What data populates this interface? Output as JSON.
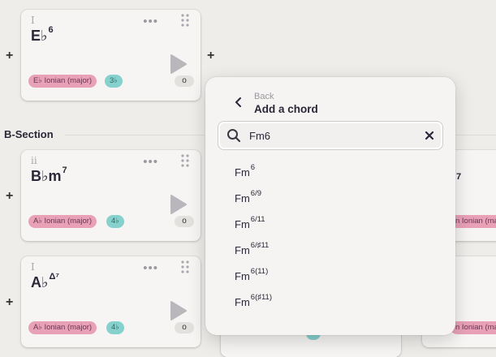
{
  "cards": [
    {
      "numeral": "I",
      "root": "E♭",
      "quality": "6",
      "scale_tag": "E♭ Ionian (major)",
      "acc_tag": "3♭",
      "circle": "o"
    },
    {
      "numeral": "ii",
      "root": "B♭m",
      "quality": "7",
      "scale_tag": "A♭ Ionian (major)",
      "acc_tag": "4♭",
      "circle": "o"
    },
    {
      "numeral": "I",
      "root": "A♭",
      "quality": "Δ⁷",
      "scale_tag": "A♭ Ionian (major)",
      "acc_tag": "4♭",
      "circle": "o"
    }
  ],
  "right_cards": [
    {
      "quality": "7",
      "scale_tag": "n Ionian (major)"
    },
    {
      "scale_tag": "n Ionian (major)"
    }
  ],
  "plus": "+",
  "section": {
    "title": "B-Section"
  },
  "popup": {
    "back_label": "Back",
    "title": "Add a chord",
    "search_value": "Fm6",
    "results": [
      {
        "base": "Fm",
        "ext": "6"
      },
      {
        "base": "Fm",
        "ext": "6/9"
      },
      {
        "base": "Fm",
        "ext": "6/11"
      },
      {
        "base": "Fm",
        "ext": "6/♯11"
      },
      {
        "base": "Fm",
        "ext": "6(11)"
      },
      {
        "base": "Fm",
        "ext": "6(♯11)"
      }
    ]
  },
  "icons": {
    "more": "more-dots-icon",
    "drag": "drag-handle-icon",
    "play": "play-icon",
    "back": "chevron-left-icon",
    "search": "search-icon",
    "clear": "clear-x-icon"
  },
  "colors": {
    "scale_tag": "#e9a1b8",
    "acc_tag": "#86d1cd",
    "background": "#efedea"
  }
}
